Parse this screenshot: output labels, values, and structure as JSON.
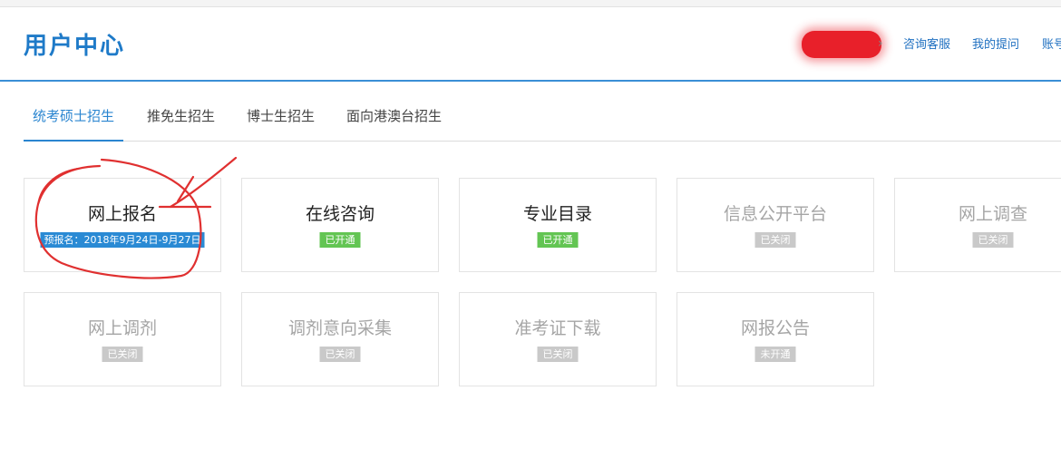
{
  "header": {
    "title": "用户中心",
    "links": [
      "咨询客服",
      "我的提问",
      "账号"
    ]
  },
  "tabs": [
    "统考硕士招生",
    "推免生招生",
    "博士生招生",
    "面向港澳台招生"
  ],
  "active_tab_index": 0,
  "cards": [
    {
      "title": "网上报名",
      "badge": "预报名：2018年9月24日-9月27日",
      "status": "date"
    },
    {
      "title": "在线咨询",
      "badge": "已开通",
      "status": "open"
    },
    {
      "title": "专业目录",
      "badge": "已开通",
      "status": "open"
    },
    {
      "title": "信息公开平台",
      "badge": "已关闭",
      "status": "closed"
    },
    {
      "title": "网上调查",
      "badge": "已关闭",
      "status": "closed"
    },
    {
      "title": "网上调剂",
      "badge": "已关闭",
      "status": "closed"
    },
    {
      "title": "调剂意向采集",
      "badge": "已关闭",
      "status": "closed"
    },
    {
      "title": "准考证下载",
      "badge": "已关闭",
      "status": "closed"
    },
    {
      "title": "网报公告",
      "badge": "未开通",
      "status": "closed"
    }
  ],
  "colors": {
    "brand_blue": "#1e7ac8",
    "open_green": "#63c553",
    "closed_gray": "#c9c9c9",
    "annotation_red": "#e03030"
  },
  "icons": {
    "redaction": "red-scribble-redaction",
    "annotation": "hand-drawn-circle-and-arrow"
  }
}
